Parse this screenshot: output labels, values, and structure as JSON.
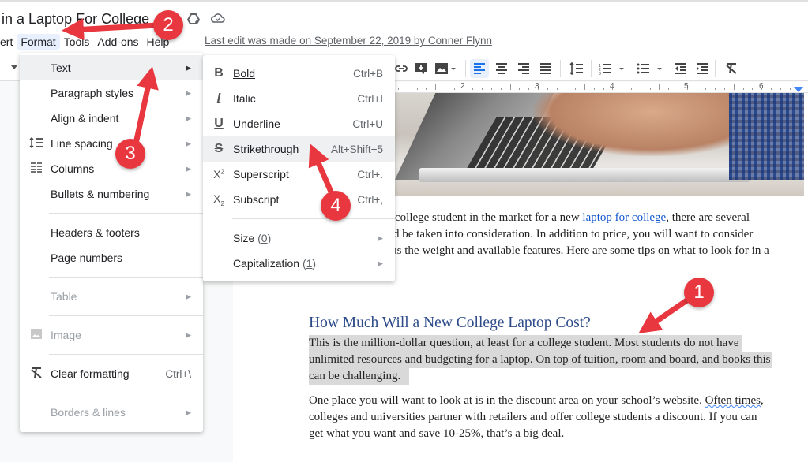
{
  "header": {
    "doc_title": "in a Laptop For College",
    "icons": [
      "drive-add-icon",
      "cloud-saved-icon"
    ],
    "menubar": [
      "ert",
      "Format",
      "Tools",
      "Add-ons",
      "Help"
    ],
    "active_menu": "Format",
    "last_edit": "Last edit was made on September 22, 2019 by Conner Flynn"
  },
  "toolbar": {
    "icons": [
      "link-icon",
      "add-comment-icon",
      "insert-image-icon",
      "align-left-icon",
      "align-center-icon",
      "align-right-icon",
      "align-justify-icon",
      "line-spacing-icon",
      "numbered-list-icon",
      "bulleted-list-icon",
      "decrease-indent-icon",
      "increase-indent-icon",
      "clear-formatting-icon"
    ],
    "active": "align-left-icon"
  },
  "ruler": {
    "labels": [
      "2",
      "3",
      "4",
      "5",
      "6"
    ]
  },
  "format_menu": {
    "items": [
      {
        "label": "Text",
        "submenu": true,
        "hover": true
      },
      {
        "label": "Paragraph styles",
        "submenu": true
      },
      {
        "label": "Align & indent",
        "submenu": true
      },
      {
        "label": "Line spacing",
        "submenu": true,
        "icon": "line-spacing-icon"
      },
      {
        "label": "Columns",
        "submenu": true,
        "icon": "columns-icon"
      },
      {
        "label": "Bullets & numbering",
        "submenu": true
      },
      {
        "label": "Headers & footers"
      },
      {
        "label": "Page numbers"
      },
      {
        "label": "Table",
        "submenu": true,
        "disabled": true
      },
      {
        "label": "Image",
        "submenu": true,
        "disabled": true,
        "icon": "image-icon"
      },
      {
        "label": "Clear formatting",
        "shortcut": "Ctrl+\\",
        "icon": "clear-formatting-icon"
      },
      {
        "label": "Borders & lines",
        "submenu": true,
        "disabled": true
      }
    ]
  },
  "text_submenu": {
    "items": [
      {
        "label": "Bold",
        "shortcut": "Ctrl+B",
        "icon": "bold-icon"
      },
      {
        "label": "Italic",
        "shortcut": "Ctrl+I",
        "icon": "italic-icon"
      },
      {
        "label": "Underline",
        "shortcut": "Ctrl+U",
        "icon": "underline-icon"
      },
      {
        "label": "Strikethrough",
        "shortcut": "Alt+Shift+5",
        "icon": "strikethrough-icon",
        "hover": true
      },
      {
        "label": "Superscript",
        "shortcut": "Ctrl+.",
        "icon": "superscript-icon"
      },
      {
        "label": "Subscript",
        "shortcut": "Ctrl+,",
        "icon": "subscript-icon"
      },
      {
        "label": "Size",
        "count": "0",
        "submenu": true
      },
      {
        "label": "Capitalization",
        "count": "1",
        "submenu": true
      }
    ]
  },
  "document": {
    "intro_lines": [
      {
        "before": "college student in the market for a new ",
        "link": "laptop for college",
        "after": ", there are several"
      },
      {
        "text": "d be taken into consideration. In addition to price, you will want to consider"
      },
      {
        "text": " as the weight and available features. Here are some tips on what to look for in a"
      }
    ],
    "heading": "How Much Will a New College Laptop Cost?",
    "selected_paragraph": [
      "This is the million-dollar question, at least for a college student. Most students do not have",
      "unlimited resources and budgeting for a laptop. On top of tuition, room and board, and books this",
      "can be challenging."
    ],
    "paragraph2": {
      "line1_before": "One place you will want to look at is in the discount area on your school’s website. ",
      "line1_flagged": "Often times",
      "line1_after": ",",
      "line2": "colleges and universities partner with retailers and offer college students a discount. If you can",
      "line3": "get what you want and save 10-25%, that’s a big deal."
    }
  },
  "annotations": {
    "badges": [
      "1",
      "2",
      "3",
      "4"
    ],
    "color": "#e8373f"
  }
}
